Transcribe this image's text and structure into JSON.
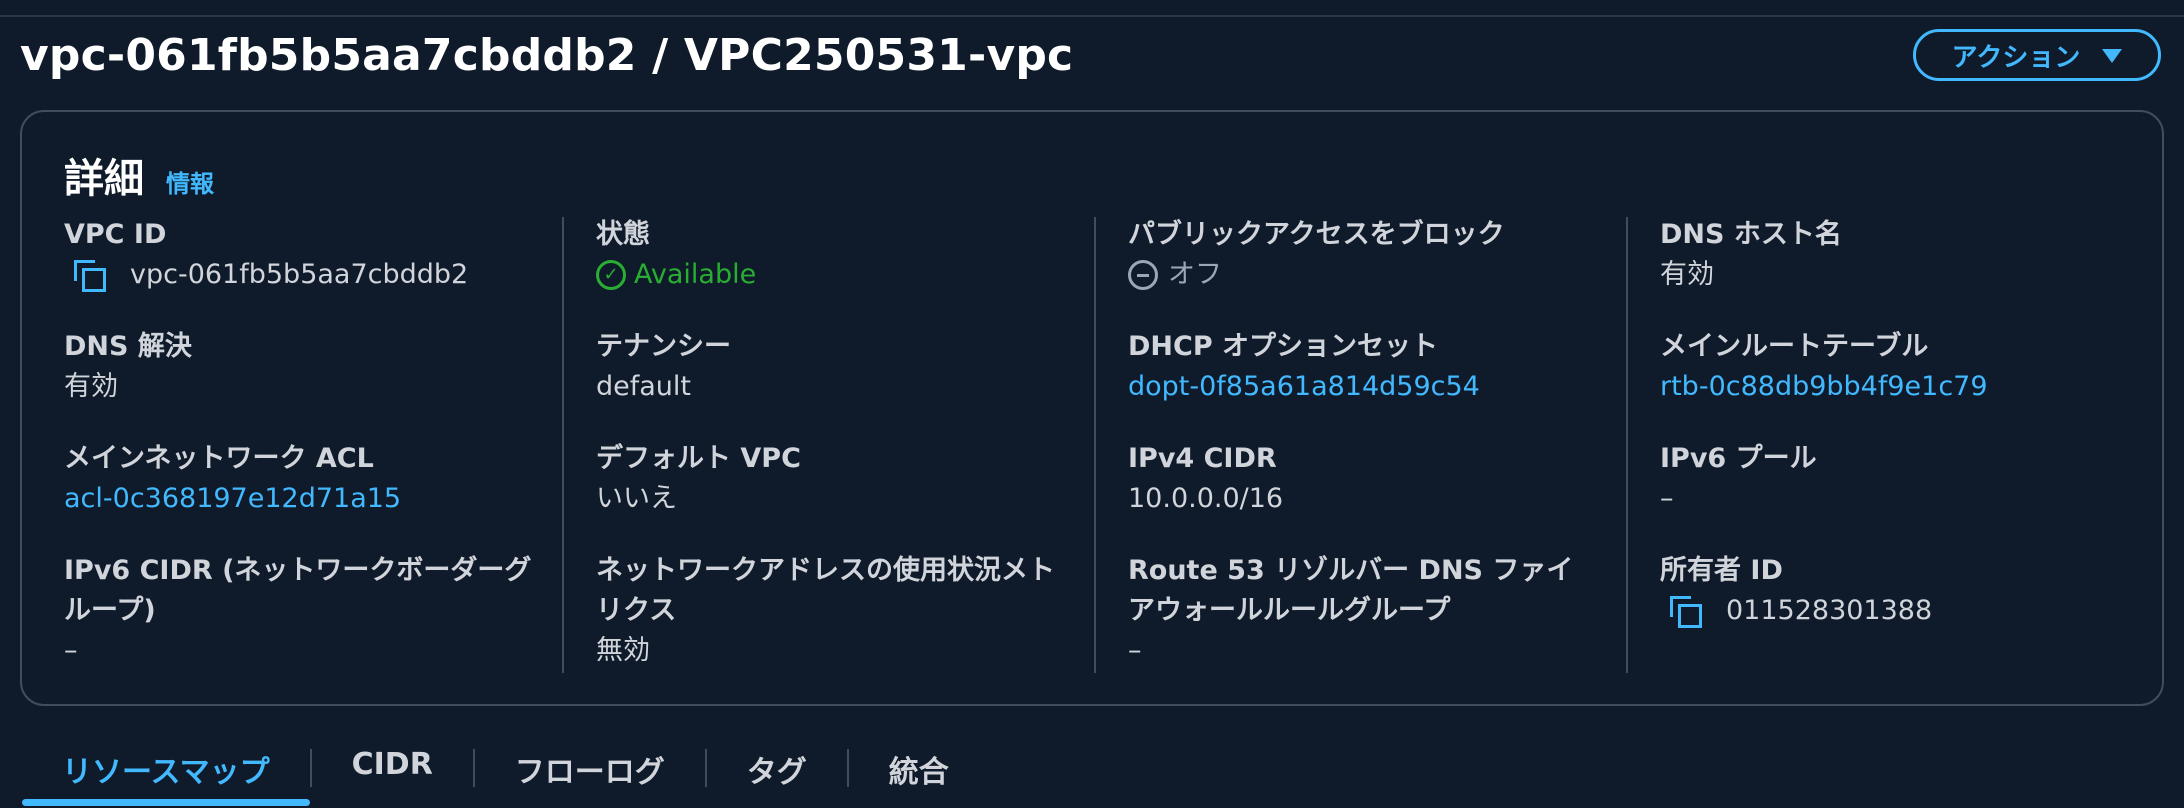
{
  "page": {
    "title": "vpc-061fb5b5aa7cbddb2 / VPC250531-vpc",
    "action_label": "アクション"
  },
  "details": {
    "title": "詳細",
    "info_link": "情報",
    "columns": [
      [
        {
          "label": "VPC ID",
          "value": "vpc-061fb5b5aa7cbddb2",
          "icon": "copy-icon"
        },
        {
          "label": "DNS 解決",
          "value": "有効"
        },
        {
          "label": "メインネットワーク ACL",
          "value": "acl-0c368197e12d71a15",
          "link": true
        },
        {
          "label": "IPv6 CIDR (ネットワークボーダーグループ)",
          "value": "–"
        }
      ],
      [
        {
          "label": "状態",
          "value": "Available",
          "icon": "check-circle-icon",
          "status_color": "#29ad32"
        },
        {
          "label": "テナンシー",
          "value": "default"
        },
        {
          "label": "デフォルト VPC",
          "value": "いいえ"
        },
        {
          "label": "ネットワークアドレスの使用状況メトリクス",
          "value": "無効"
        }
      ],
      [
        {
          "label": "パブリックアクセスをブロック",
          "value": "オフ",
          "icon": "minus-circle-icon"
        },
        {
          "label": "DHCP オプションセット",
          "value": "dopt-0f85a61a814d59c54",
          "link": true
        },
        {
          "label": "IPv4 CIDR",
          "value": "10.0.0.0/16"
        },
        {
          "label": "Route 53 リゾルバー DNS ファイアウォールルールグループ",
          "value": "–"
        }
      ],
      [
        {
          "label": "DNS ホスト名",
          "value": "有効"
        },
        {
          "label": "メインルートテーブル",
          "value": "rtb-0c88db9bb4f9e1c79",
          "link": true
        },
        {
          "label": "IPv6 プール",
          "value": "–"
        },
        {
          "label": "所有者 ID",
          "value": "011528301388",
          "icon": "copy-icon"
        }
      ]
    ]
  },
  "tabs": [
    {
      "label": "リソースマップ",
      "active": true
    },
    {
      "label": "CIDR"
    },
    {
      "label": "フローログ"
    },
    {
      "label": "タグ"
    },
    {
      "label": "統合"
    }
  ],
  "colors": {
    "background": "#0f1b2a",
    "accent": "#42b8ff",
    "success": "#29ad32",
    "border": "#414d5c"
  }
}
